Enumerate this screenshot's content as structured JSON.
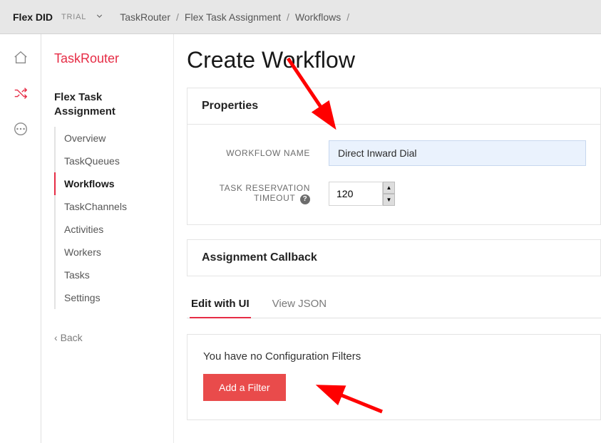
{
  "topbar": {
    "project_name": "Flex DID",
    "badge": "TRIAL",
    "breadcrumbs": [
      "TaskRouter",
      "Flex Task Assignment",
      "Workflows",
      ""
    ]
  },
  "sidebar": {
    "title": "TaskRouter",
    "group_title": "Flex Task Assignment",
    "items": [
      {
        "label": "Overview"
      },
      {
        "label": "TaskQueues"
      },
      {
        "label": "Workflows",
        "active": true
      },
      {
        "label": "TaskChannels"
      },
      {
        "label": "Activities"
      },
      {
        "label": "Workers"
      },
      {
        "label": "Tasks"
      },
      {
        "label": "Settings"
      }
    ],
    "back_label": "Back"
  },
  "content": {
    "page_title": "Create Workflow",
    "properties": {
      "heading": "Properties",
      "workflow_name_label": "WORKFLOW NAME",
      "workflow_name_value": "Direct Inward Dial",
      "timeout_label": "TASK RESERVATION TIMEOUT",
      "timeout_value": "120"
    },
    "assignment": {
      "heading": "Assignment Callback"
    },
    "tabs": {
      "edit_ui": "Edit with UI",
      "view_json": "View JSON"
    },
    "filters": {
      "empty_text": "You have no Configuration Filters",
      "add_button": "Add a Filter"
    }
  }
}
